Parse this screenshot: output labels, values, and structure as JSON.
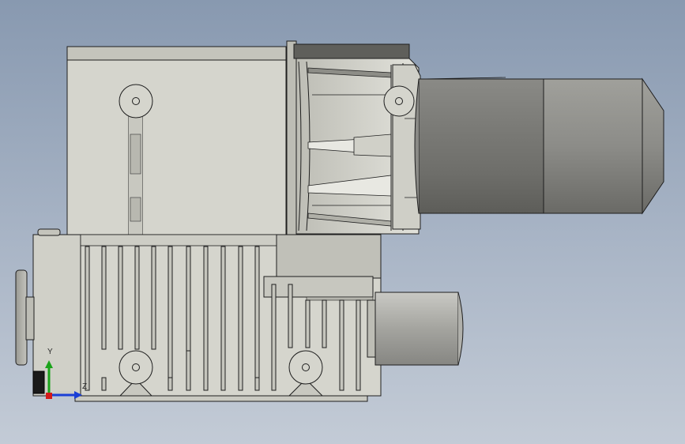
{
  "window": {
    "title": ""
  },
  "model": {
    "description_name": "vacuum-pump-assembly",
    "colors": {
      "body": "#d3d3cb",
      "body_dark": "#a8a89f",
      "edge": "#1e1e1e",
      "motor_light": "#b9b9b4",
      "motor_dark": "#6f6f6b",
      "background_top": "#8899b0",
      "background_bottom": "#c3cbd6"
    }
  },
  "triad": {
    "y_label": "Y",
    "z_label": "Z",
    "y_color": "#1aa31a",
    "z_color": "#1a3fd6",
    "x_color": "#d41a1a"
  }
}
